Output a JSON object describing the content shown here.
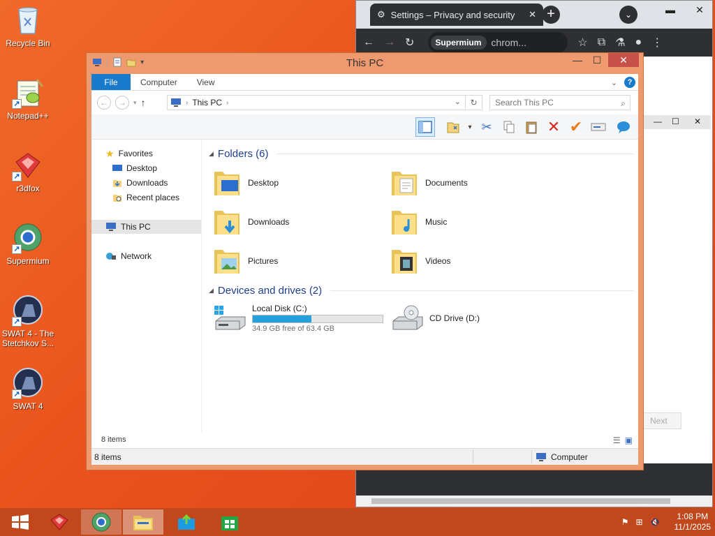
{
  "desktop": {
    "icons": [
      {
        "label": "Recycle Bin",
        "icon": "recycle-bin-icon"
      },
      {
        "label": "Notepad++",
        "icon": "notepad-plus-plus-icon"
      },
      {
        "label": "r3dfox",
        "icon": "r3dfox-icon"
      },
      {
        "label": "Supermium",
        "icon": "supermium-icon"
      },
      {
        "label": "SWAT 4 - The Stetchkov S...",
        "icon": "swat4-expansion-icon"
      },
      {
        "label": "SWAT 4",
        "icon": "swat4-icon"
      }
    ]
  },
  "chrome": {
    "tab_title": "Settings – Privacy and security",
    "site_chip": "Supermium",
    "url_text": "chrom...",
    "next_button": "Next"
  },
  "explorer": {
    "title": "This PC",
    "ribbon_tabs": [
      "File",
      "Computer",
      "View"
    ],
    "address": "This PC",
    "search_placeholder": "Search This PC",
    "nav": {
      "favorites": "Favorites",
      "desktop": "Desktop",
      "downloads": "Downloads",
      "recent": "Recent places",
      "this_pc": "This PC",
      "network": "Network"
    },
    "folders_header": "Folders (6)",
    "folders": [
      "Desktop",
      "Documents",
      "Downloads",
      "Music",
      "Pictures",
      "Videos"
    ],
    "devices_header": "Devices and drives (2)",
    "drives": {
      "local_label": "Local Disk (C:)",
      "local_free": "34.9 GB free of 63.4 GB",
      "local_used_fraction": 0.45,
      "cd_label": "CD Drive (D:)"
    },
    "status_items": "8 items",
    "bottom_status_items": "8 items",
    "bottom_status_computer": "Computer"
  },
  "taskbar": {
    "time": "1:08 PM",
    "date": "11/1/2025"
  },
  "colors": {
    "desktop": "#e9521c",
    "taskbar": "#c1481c",
    "window_frame": "#ee9a6e",
    "accent": "#1979ca",
    "folder_header": "#1e3e8c"
  }
}
